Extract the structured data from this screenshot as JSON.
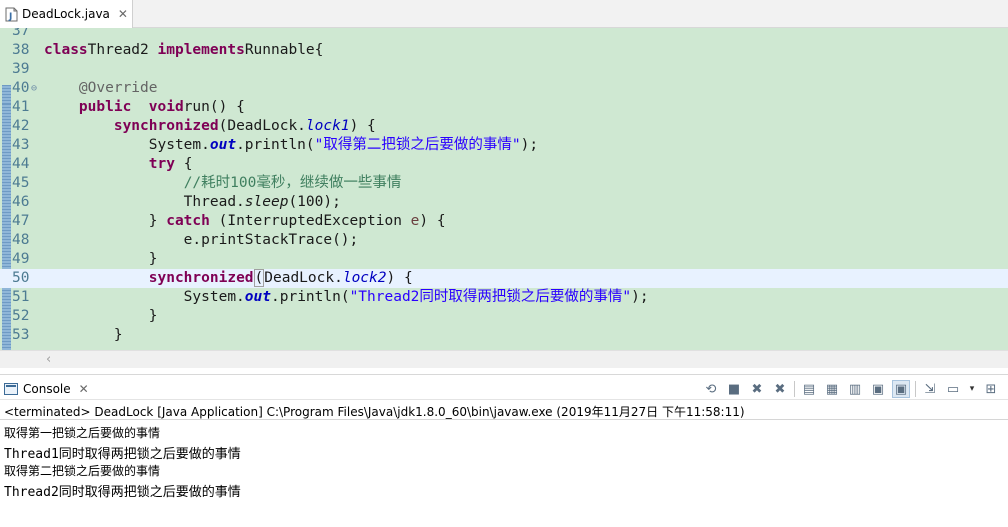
{
  "editor": {
    "tab_title": "DeadLock.java",
    "tab_close": "✕",
    "lines": [
      {
        "no": "37",
        "tokens": []
      },
      {
        "no": "38",
        "tokens": [
          [
            "kw",
            "class"
          ],
          [
            "",
            "Thread2 "
          ],
          [
            "kw",
            "implements"
          ],
          [
            "",
            "Runnable{"
          ]
        ]
      },
      {
        "no": "39",
        "tokens": []
      },
      {
        "no": "40",
        "fold": "⊖",
        "tokens": [
          [
            "",
            "    "
          ],
          [
            "ann",
            "@Override"
          ]
        ]
      },
      {
        "no": "41",
        "tokens": [
          [
            "",
            "    "
          ],
          [
            "kw",
            "public"
          ],
          [
            "",
            "  "
          ],
          [
            "kw",
            "void"
          ],
          [
            "",
            "run() {"
          ]
        ]
      },
      {
        "no": "42",
        "tokens": [
          [
            "",
            "        "
          ],
          [
            "kw",
            "synchronized"
          ],
          [
            "",
            "(DeadLock."
          ],
          [
            "fld",
            "lock1"
          ],
          [
            "",
            ") {"
          ]
        ]
      },
      {
        "no": "43",
        "tokens": [
          [
            "",
            "            System."
          ],
          [
            "fldb",
            "out"
          ],
          [
            "",
            ".println("
          ],
          [
            "str",
            "\"取得第二把锁之后要做的事情\""
          ],
          [
            "",
            ");"
          ]
        ]
      },
      {
        "no": "44",
        "tokens": [
          [
            "",
            "            "
          ],
          [
            "kw",
            "try"
          ],
          [
            "",
            "",
            " {"
          ]
        ]
      },
      {
        "no": "45",
        "tokens": [
          [
            "",
            "                "
          ],
          [
            "cmt",
            "//耗时100毫秒，继续做一些事情"
          ]
        ]
      },
      {
        "no": "46",
        "tokens": [
          [
            "",
            "                Thread."
          ],
          [
            "ital",
            "sleep"
          ],
          [
            "",
            "(100);"
          ]
        ]
      },
      {
        "no": "47",
        "tokens": [
          [
            "",
            "            } "
          ],
          [
            "kw",
            "catch"
          ],
          [
            "",
            " (InterruptedException "
          ],
          [
            "loc",
            "e"
          ],
          [
            "",
            ") {"
          ]
        ]
      },
      {
        "no": "48",
        "tokens": [
          [
            "",
            "                e.printStackTrace();"
          ]
        ]
      },
      {
        "no": "49",
        "tokens": [
          [
            "",
            "            }"
          ]
        ]
      },
      {
        "no": "50",
        "current": true,
        "tokens": [
          [
            "",
            "            "
          ],
          [
            "kw",
            "synchronized"
          ],
          [
            "box",
            "("
          ],
          [
            "",
            "DeadLock."
          ],
          [
            "fld",
            "lock2"
          ],
          [
            "",
            ") {"
          ]
        ]
      },
      {
        "no": "51",
        "tokens": [
          [
            "",
            "                System."
          ],
          [
            "fldb",
            "out"
          ],
          [
            "",
            ".println("
          ],
          [
            "str",
            "\"Thread2同时取得两把锁之后要做的事情\""
          ],
          [
            "",
            ");"
          ]
        ]
      },
      {
        "no": "52",
        "tokens": [
          [
            "",
            "            }"
          ]
        ]
      },
      {
        "no": "53",
        "tokens": [
          [
            "",
            "        }"
          ]
        ]
      }
    ],
    "scroll_arrow": "‹"
  },
  "console": {
    "tab_title": "Console",
    "tab_close": "✕",
    "status": "<terminated> DeadLock [Java Application] C:\\Program Files\\Java\\jdk1.8.0_60\\bin\\javaw.exe (2019年11月27日 下午11:58:11)",
    "output": [
      {
        "text": "取得第一把锁之后要做的事情",
        "style": "cjk"
      },
      {
        "text": "Thread1同时取得两把锁之后要做的事情",
        "style": "mono"
      },
      {
        "text": "取得第二把锁之后要做的事情",
        "style": "cjk"
      },
      {
        "text": "Thread2同时取得两把锁之后要做的事情",
        "style": "mono"
      }
    ],
    "toolbar": [
      {
        "name": "pin-console-icon",
        "glyph": "⟲"
      },
      {
        "name": "terminate-icon",
        "glyph": "■"
      },
      {
        "name": "remove-launch-icon",
        "glyph": "✖"
      },
      {
        "name": "remove-all-terminated-icon",
        "glyph": "✖"
      },
      {
        "name": "sep",
        "glyph": ""
      },
      {
        "name": "clear-console-icon",
        "glyph": "▤"
      },
      {
        "name": "scroll-lock-icon",
        "glyph": "▦"
      },
      {
        "name": "word-wrap-icon",
        "glyph": "▥"
      },
      {
        "name": "show-on-stdout-icon",
        "glyph": "▣"
      },
      {
        "name": "show-on-stderr-icon",
        "glyph": "▣",
        "pressed": true
      },
      {
        "name": "sep",
        "glyph": ""
      },
      {
        "name": "pin-icon",
        "glyph": "⇲"
      },
      {
        "name": "display-selected-console-icon",
        "glyph": "▭"
      },
      {
        "name": "dropdown-icon",
        "glyph": "▾",
        "small": true
      },
      {
        "name": "open-console-icon",
        "glyph": "⊞"
      }
    ]
  }
}
